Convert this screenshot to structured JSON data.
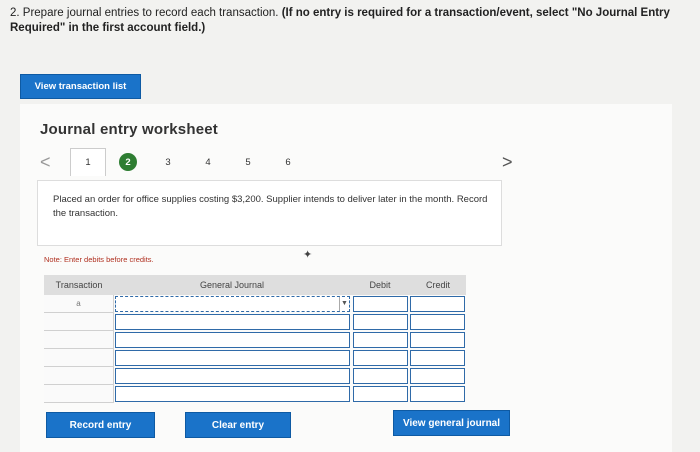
{
  "question": {
    "text": "2. Prepare journal entries to record each transaction.",
    "instruction": "(If no entry is required for a transaction/event, select \"No Journal Entry Required\" in the first account field.)"
  },
  "buttons": {
    "view_transaction_list": "View transaction list",
    "record_entry": "Record entry",
    "clear_entry": "Clear entry",
    "view_general_journal": "View general journal"
  },
  "worksheet": {
    "title": "Journal entry worksheet",
    "nav_prev": "<",
    "nav_next": ">",
    "tabs": [
      "1",
      "2",
      "3",
      "4",
      "5",
      "6"
    ],
    "description": "Placed an order for office supplies costing $3,200. Supplier intends to deliver later in the month. Record the transaction.",
    "note": "Note: Enter debits before credits."
  },
  "table": {
    "columns": {
      "transaction": "Transaction",
      "general_journal": "General Journal",
      "debit": "Debit",
      "credit": "Credit"
    },
    "rows": [
      {
        "transaction": "a"
      },
      {
        "transaction": ""
      },
      {
        "transaction": ""
      },
      {
        "transaction": ""
      },
      {
        "transaction": ""
      },
      {
        "transaction": ""
      }
    ]
  },
  "colors": {
    "primary_button": "#1a73c9",
    "active_step": "#2e7d32",
    "note_text": "#b03020"
  }
}
